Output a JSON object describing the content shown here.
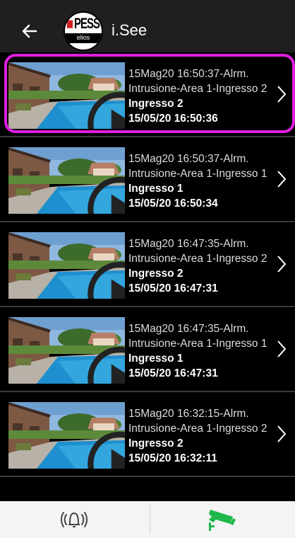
{
  "header": {
    "title": "i.See",
    "logo_top": "PESS",
    "logo_bottom": "elios"
  },
  "events": [
    {
      "line1": "15Mag20 16:50:37-Alrm.",
      "line2": "Intrusione-Area 1-Ingresso 2",
      "camera": "Ingresso 2",
      "datetime": "15/05/20 16:50:36",
      "selected": true
    },
    {
      "line1": "15Mag20 16:50:37-Alrm.",
      "line2": "Intrusione-Area 1-Ingresso 1",
      "camera": "Ingresso 1",
      "datetime": "15/05/20 16:50:34",
      "selected": false
    },
    {
      "line1": "15Mag20 16:47:35-Alrm.",
      "line2": "Intrusione-Area 1-Ingresso 2",
      "camera": "Ingresso 2",
      "datetime": "15/05/20 16:47:31",
      "selected": false
    },
    {
      "line1": "15Mag20 16:47:35-Alrm.",
      "line2": "Intrusione-Area 1-Ingresso 1",
      "camera": "Ingresso 1",
      "datetime": "15/05/20 16:47:31",
      "selected": false
    },
    {
      "line1": "15Mag20 16:32:15-Alrm.",
      "line2": "Intrusione-Area 1-Ingresso 2",
      "camera": "Ingresso 2",
      "datetime": "15/05/20 16:32:11",
      "selected": false
    }
  ],
  "bottom_nav": {
    "tabs": [
      {
        "icon": "bell-ringing-icon",
        "active": false
      },
      {
        "icon": "cctv-camera-icon",
        "active": true
      }
    ]
  },
  "colors": {
    "header_bg": "#1f1f1f",
    "highlight": "#e01ee0",
    "active_tab_icon": "#1fb84a",
    "inactive_tab_icon": "#444444"
  }
}
